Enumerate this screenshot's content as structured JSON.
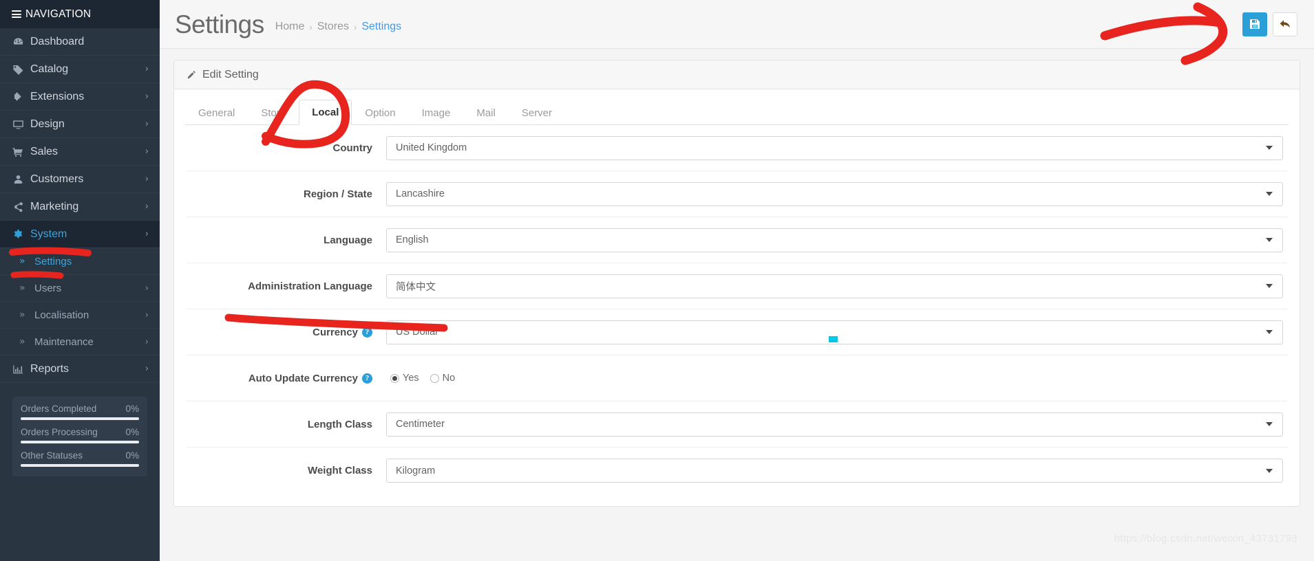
{
  "sidebar": {
    "nav_header": "NAVIGATION",
    "items": [
      {
        "label": "Dashboard",
        "icon": "dashboard-icon",
        "caret": "",
        "active": false
      },
      {
        "label": "Catalog",
        "icon": "tag-icon",
        "caret": "›",
        "active": false
      },
      {
        "label": "Extensions",
        "icon": "puzzle-icon",
        "caret": "›",
        "active": false
      },
      {
        "label": "Design",
        "icon": "monitor-icon",
        "caret": "›",
        "active": false
      },
      {
        "label": "Sales",
        "icon": "cart-icon",
        "caret": "›",
        "active": false
      },
      {
        "label": "Customers",
        "icon": "user-icon",
        "caret": "›",
        "active": false
      },
      {
        "label": "Marketing",
        "icon": "share-icon",
        "caret": "›",
        "active": false
      },
      {
        "label": "System",
        "icon": "gear-icon",
        "caret": "›",
        "active": true
      }
    ],
    "sub_items": [
      {
        "label": "Settings",
        "chevron": "»",
        "caret": "",
        "active": true
      },
      {
        "label": "Users",
        "chevron": "»",
        "caret": "›",
        "active": false
      },
      {
        "label": "Localisation",
        "chevron": "»",
        "caret": "›",
        "active": false
      },
      {
        "label": "Maintenance",
        "chevron": "»",
        "caret": "›",
        "active": false
      }
    ],
    "items_after": [
      {
        "label": "Reports",
        "icon": "chart-bar-icon",
        "caret": "›",
        "active": false
      }
    ],
    "stats": [
      {
        "label": "Orders Completed",
        "value": "0%"
      },
      {
        "label": "Orders Processing",
        "value": "0%"
      },
      {
        "label": "Other Statuses",
        "value": "0%"
      }
    ]
  },
  "header": {
    "title": "Settings",
    "breadcrumb": [
      {
        "label": "Home",
        "current": false
      },
      {
        "label": "Stores",
        "current": false
      },
      {
        "label": "Settings",
        "current": true
      }
    ],
    "separator": "›",
    "save_button": "save-button",
    "back_button": "back-button"
  },
  "panel": {
    "heading": "Edit Setting",
    "tabs": [
      {
        "label": "General",
        "active": false
      },
      {
        "label": "Store",
        "active": false
      },
      {
        "label": "Local",
        "active": true
      },
      {
        "label": "Option",
        "active": false
      },
      {
        "label": "Image",
        "active": false
      },
      {
        "label": "Mail",
        "active": false
      },
      {
        "label": "Server",
        "active": false
      }
    ],
    "fields": [
      {
        "name": "country",
        "label": "Country",
        "type": "select",
        "value": "United Kingdom",
        "help": false
      },
      {
        "name": "region-state",
        "label": "Region / State",
        "type": "select",
        "value": "Lancashire",
        "help": false
      },
      {
        "name": "language",
        "label": "Language",
        "type": "select",
        "value": "English",
        "help": false
      },
      {
        "name": "administration-language",
        "label": "Administration Language",
        "type": "select",
        "value": "简体中文",
        "help": false
      },
      {
        "name": "currency",
        "label": "Currency",
        "type": "select",
        "value": "US Dollar",
        "help": true
      },
      {
        "name": "auto-update-currency",
        "label": "Auto Update Currency",
        "type": "radio",
        "help": true,
        "options": [
          {
            "label": "Yes",
            "checked": true
          },
          {
            "label": "No",
            "checked": false
          }
        ]
      },
      {
        "name": "length-class",
        "label": "Length Class",
        "type": "select",
        "value": "Centimeter",
        "help": false
      },
      {
        "name": "weight-class",
        "label": "Weight Class",
        "type": "select",
        "value": "Kilogram",
        "help": false
      }
    ]
  },
  "watermark": "https://blog.csdn.net/weixin_43731793",
  "colors": {
    "sidebar_bg": "#2a3542",
    "sidebar_header_bg": "#1c2733",
    "accent_blue": "#2a9fd8",
    "link_blue": "#3d9be9",
    "annotation_red": "#e8241e"
  },
  "annotations": {
    "arrow_to_save": "red-arrow-annotation",
    "circle_local_tab": "red-circle-annotation",
    "underline_system": "red-underline-annotation",
    "underline_settings": "red-underline-annotation",
    "underline_admin_language": "red-underline-annotation"
  }
}
